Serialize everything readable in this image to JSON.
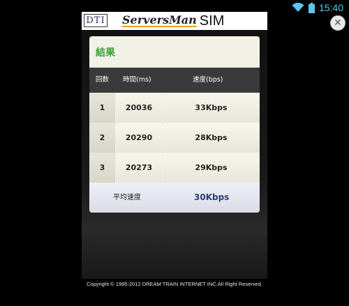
{
  "status_bar": {
    "time": "15:40",
    "icons": [
      "wifi-icon",
      "battery-icon"
    ],
    "accent_color": "#5bc6ea"
  },
  "header": {
    "dti_logo_text": "DTI",
    "brand_name": "ServersMan",
    "brand_suffix": "SIM"
  },
  "close_icon": "close-icon",
  "result": {
    "title": "結果",
    "title_color": "#3ca03c",
    "columns": {
      "count": "回数",
      "time": "時間(ms)",
      "speed": "速度(bps)"
    },
    "rows": [
      {
        "count": "1",
        "time": "20036",
        "speed": "33Kbps"
      },
      {
        "count": "2",
        "time": "20290",
        "speed": "28Kbps"
      },
      {
        "count": "3",
        "time": "20273",
        "speed": "29Kbps"
      }
    ],
    "average_label": "平均速度",
    "average_value": "30Kbps"
  },
  "footer": {
    "copyright": "Copyright © 1995-2012 DREAM TRAIN INTERNET INC.All Right Reserved."
  }
}
